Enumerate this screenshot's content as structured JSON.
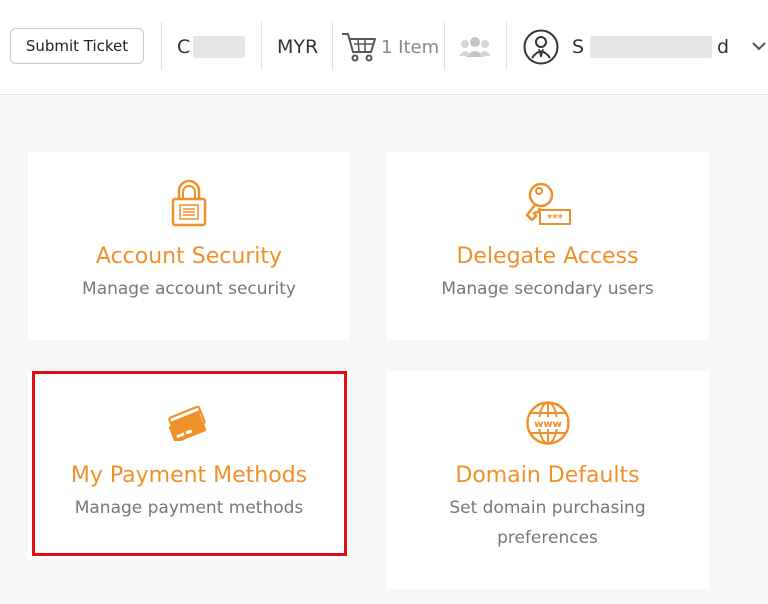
{
  "header": {
    "submit_ticket_label": "Submit Ticket",
    "account_initial": "C",
    "currency": "MYR",
    "cart_label": "1 Item",
    "user_initial": "S",
    "user_last": "d"
  },
  "cards": [
    {
      "title": "Account Security",
      "desc": "Manage account security",
      "icon": "lock-icon"
    },
    {
      "title": "Delegate Access",
      "desc": "Manage secondary users",
      "icon": "key-icon"
    },
    {
      "title": "My Payment Methods",
      "desc": "Manage payment methods",
      "icon": "credit-cards-icon"
    },
    {
      "title": "Domain Defaults",
      "desc_line1": "Set domain purchasing",
      "desc_line2": "preferences",
      "icon": "globe-www-icon"
    }
  ],
  "colors": {
    "accent": "#f0902a",
    "highlight": "#e01010",
    "background": "#f5f7f8"
  }
}
